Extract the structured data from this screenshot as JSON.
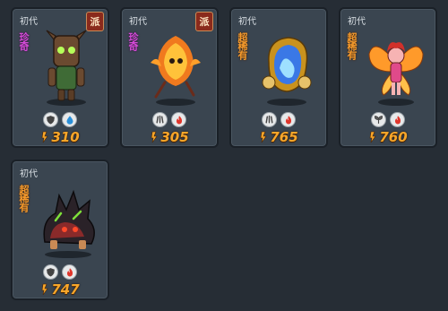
{
  "cards": [
    {
      "gen": "初代",
      "faction": "派",
      "rarity": "珍奇",
      "power": "310",
      "element_icons": [
        "shield-icon",
        "water-drop-icon"
      ]
    },
    {
      "gen": "初代",
      "faction": "派",
      "rarity": "珍奇",
      "power": "305",
      "element_icons": [
        "claw-icon",
        "fire-icon"
      ]
    },
    {
      "gen": "初代",
      "rarity": "超稀有",
      "power": "765",
      "element_icons": [
        "claw-icon",
        "fire-icon"
      ]
    },
    {
      "gen": "初代",
      "rarity": "超稀有",
      "power": "760",
      "element_icons": [
        "leaf-icon",
        "fire-icon"
      ]
    },
    {
      "gen": "初代",
      "rarity": "超稀有",
      "power": "747",
      "element_icons": [
        "shield-icon",
        "fire-icon"
      ]
    }
  ],
  "colors": {
    "rarity_rare": "#d34bd7",
    "rarity_super": "#f59a2c",
    "power": "#f7a62a",
    "fire": "#e0362c",
    "water": "#2a8fd8"
  }
}
